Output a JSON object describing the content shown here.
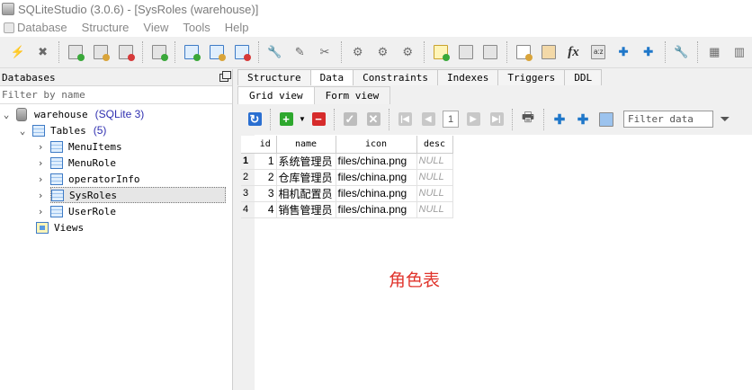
{
  "window": {
    "title": "SQLiteStudio (3.0.6) - [SysRoles (warehouse)]"
  },
  "menu": [
    {
      "label": "Database",
      "icon": "database-icon"
    },
    {
      "label": "Structure"
    },
    {
      "label": "View"
    },
    {
      "label": "Tools"
    },
    {
      "label": "Help"
    }
  ],
  "left_panel": {
    "title": "Databases",
    "filter_placeholder": "Filter by name",
    "database": {
      "name": "warehouse",
      "version": "(SQLite 3)"
    },
    "tables_group": {
      "label": "Tables",
      "count": "(5)"
    },
    "tables": [
      "MenuItems",
      "MenuRole",
      "operatorInfo",
      "SysRoles",
      "UserRole"
    ],
    "selected_table": "SysRoles",
    "views_label": "Views"
  },
  "tabs": [
    "Structure",
    "Data",
    "Constraints",
    "Indexes",
    "Triggers",
    "DDL"
  ],
  "active_tab": "Data",
  "subtabs": [
    "Grid view",
    "Form view"
  ],
  "active_subtab": "Grid view",
  "data_toolbar": {
    "page": "1",
    "filter_placeholder": "Filter data"
  },
  "grid": {
    "columns": [
      "id",
      "name",
      "icon",
      "desc"
    ],
    "rows": [
      {
        "rownum": "1",
        "id": "1",
        "name": "系统管理员",
        "icon": "files/china.png",
        "desc": "NULL"
      },
      {
        "rownum": "2",
        "id": "2",
        "name": "仓库管理员",
        "icon": "files/china.png",
        "desc": "NULL"
      },
      {
        "rownum": "3",
        "id": "3",
        "name": "相机配置员",
        "icon": "files/china.png",
        "desc": "NULL"
      },
      {
        "rownum": "4",
        "id": "4",
        "name": "销售管理员",
        "icon": "files/china.png",
        "desc": "NULL"
      }
    ]
  },
  "annotation": "角色表",
  "colors": {
    "annotation": "#e0342c",
    "tree_meta": "#2f2fb0",
    "null_text": "#a0a0a0"
  }
}
